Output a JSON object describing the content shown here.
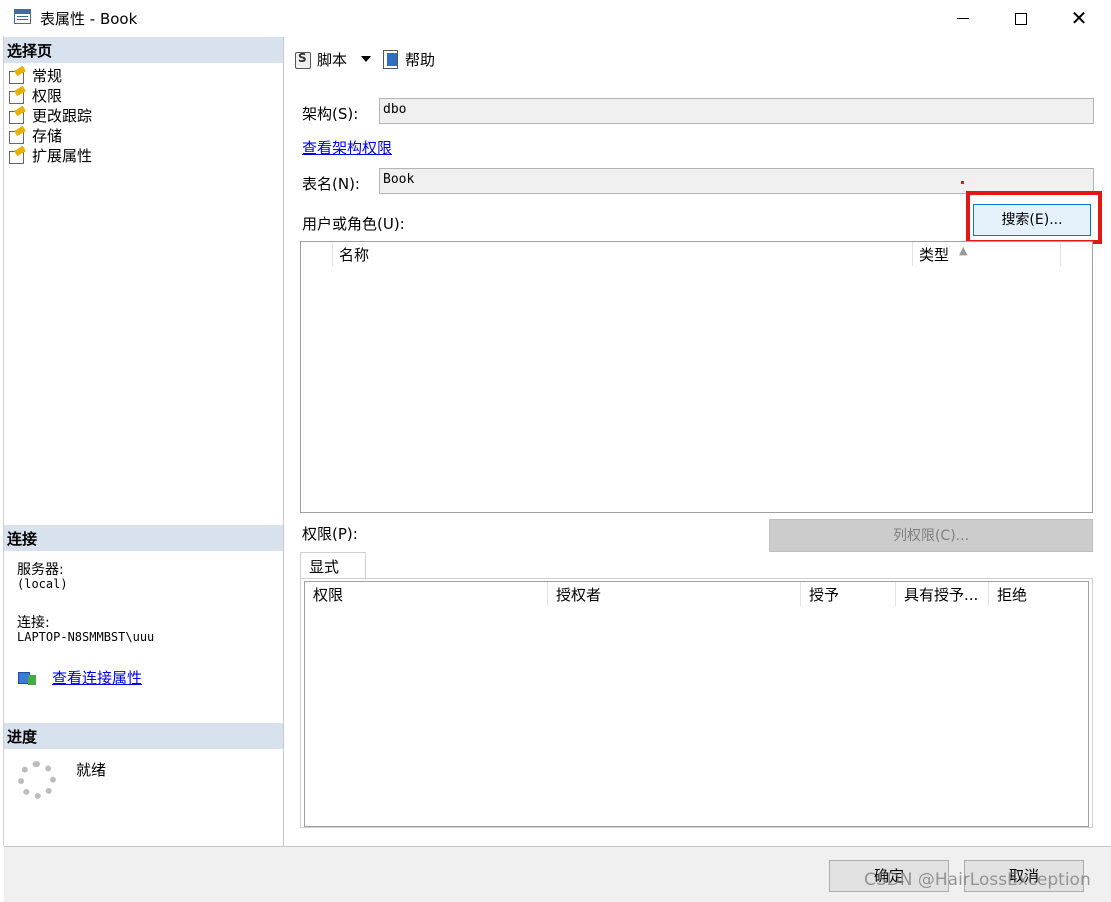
{
  "window": {
    "title": "表属性 - Book",
    "minimize": "minimize",
    "maximize": "maximize",
    "close": "✕"
  },
  "left": {
    "select_page_header": "选择页",
    "nav_items": [
      {
        "label": "常规"
      },
      {
        "label": "权限"
      },
      {
        "label": "更改跟踪"
      },
      {
        "label": "存储"
      },
      {
        "label": "扩展属性"
      }
    ],
    "connection_header": "连接",
    "server_label": "服务器:",
    "server_value": "(local)",
    "connection_label": "连接:",
    "connection_value": "LAPTOP-N8SMMBST\\uuu",
    "view_connection_link": "查看连接属性",
    "progress_header": "进度",
    "progress_status": "就绪"
  },
  "toolbar": {
    "script_label": "脚本",
    "help_label": "帮助"
  },
  "form": {
    "schema_label": "架构(S):",
    "schema_value": "dbo",
    "view_schema_link": "查看架构权限",
    "table_name_label": "表名(N):",
    "table_name_value": "Book",
    "users_label": "用户或角色(U):",
    "search_button": "搜索(E)...",
    "users_columns": [
      "名称",
      "类型"
    ],
    "permissions_label": "权限(P):",
    "column_permissions_button": "列权限(C)...",
    "tab_explicit": "显式",
    "permission_columns": [
      "权限",
      "授权者",
      "授予",
      "具有授予...",
      "拒绝"
    ]
  },
  "buttons": {
    "ok": "确定",
    "cancel": "取消"
  },
  "watermark": "CSDN @HairLossException",
  "colors": {
    "highlight_box": "#e01818",
    "section_header_bg": "#d8e2ee",
    "link": "#0000ee"
  }
}
